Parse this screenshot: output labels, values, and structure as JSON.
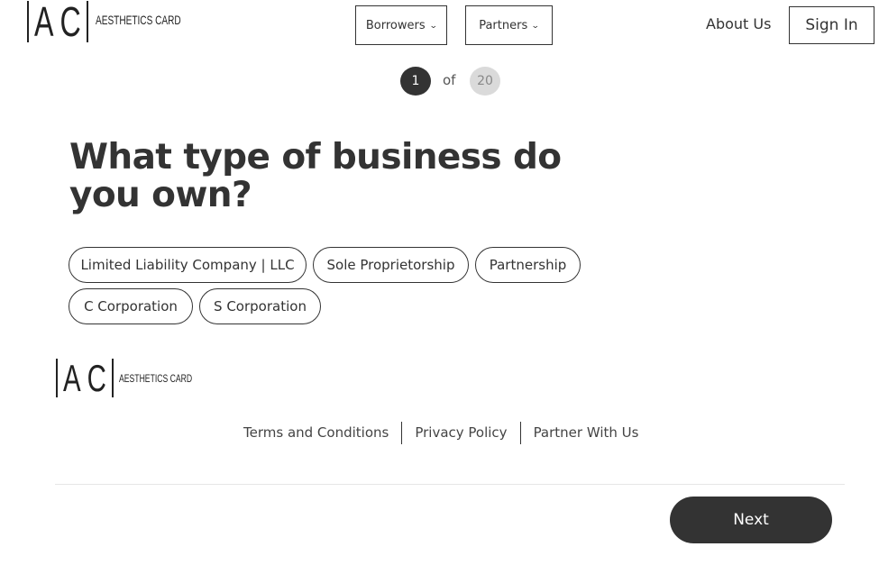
{
  "header": {
    "logo": {
      "letters": "AC",
      "brand": "AESTHETICS CARD"
    },
    "nav": {
      "borrowers_label": "Borrowers",
      "partners_label": "Partners",
      "about_label": "About Us",
      "signin_label": "Sign In"
    }
  },
  "progress": {
    "current": "1",
    "of_label": "of",
    "total": "20"
  },
  "question": {
    "title": "What type of business do you own?",
    "options": [
      "Limited Liability Company | LLC",
      "Sole Proprietorship",
      "Partnership",
      "C Corporation",
      "S Corporation"
    ]
  },
  "footer": {
    "logo": {
      "letters": "AC",
      "brand": "AESTHETICS CARD"
    },
    "links": [
      "Terms and Conditions",
      "Privacy Policy",
      "Partner With Us"
    ]
  },
  "actions": {
    "next_label": "Next"
  },
  "colors": {
    "primary_dark": "#333333",
    "step_inactive": "#dadada",
    "background": "#ffffff"
  }
}
